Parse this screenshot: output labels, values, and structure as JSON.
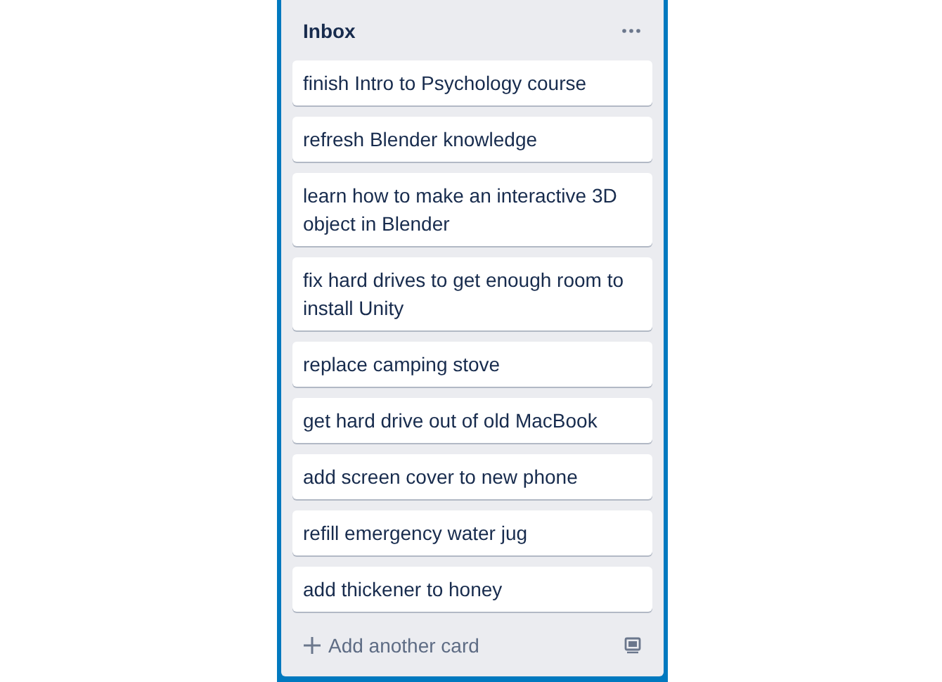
{
  "list": {
    "title": "Inbox",
    "cards": [
      {
        "text": "finish Intro to Psychology course"
      },
      {
        "text": "refresh Blender knowledge"
      },
      {
        "text": "learn how to make an interactive 3D object in Blender"
      },
      {
        "text": "fix hard drives to get enough room to install Unity"
      },
      {
        "text": "replace camping stove"
      },
      {
        "text": "get hard drive out of old MacBook"
      },
      {
        "text": "add screen cover to new phone"
      },
      {
        "text": "refill emergency water jug"
      },
      {
        "text": "add thickener to honey"
      }
    ],
    "add_button": "Add another card"
  }
}
